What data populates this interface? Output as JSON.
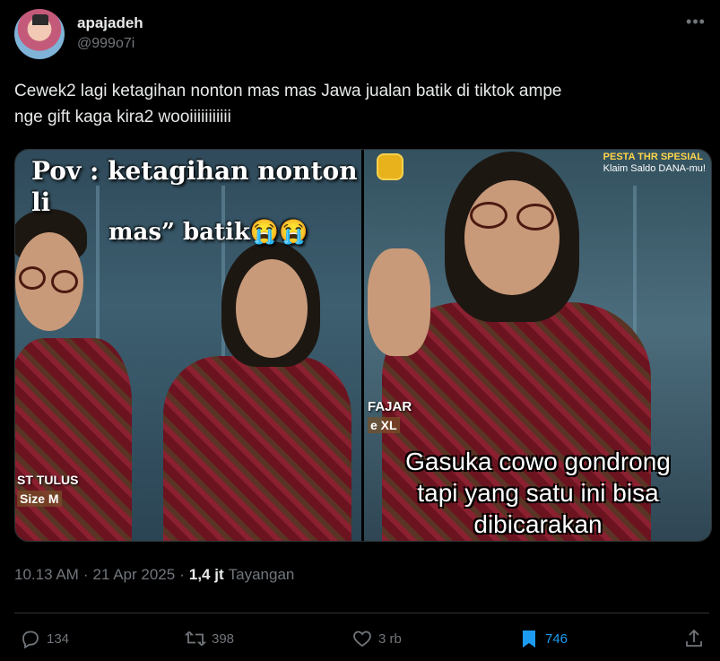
{
  "author": {
    "display_name": "apajadeh",
    "handle": "@999o7i"
  },
  "tweet": {
    "text": "Cewek2 lagi ketagihan nonton mas mas Jawa jualan batik di tiktok ampe\nnge gift kaga kira2 wooiiiiiiiiiii"
  },
  "media": {
    "left": {
      "caption_line1": "Pov : ketagihan nonton li",
      "caption_line2": "mas” batik😭😭",
      "name_label": "ST TULUS",
      "size_label": "Size M"
    },
    "right": {
      "promo_title": "PESTA THR SPESIAL",
      "promo_sub": "Klaim Saldo DANA-mu!",
      "name_label": "FAJAR",
      "size_label": "e XL",
      "caption": "Gasuka cowo gondrong\ntapi yang satu ini bisa\ndibicarakan"
    }
  },
  "meta": {
    "time": "10.13 AM",
    "sep1": "·",
    "date": "21 Apr 2025",
    "sep2": "·",
    "views": "1,4 jt",
    "views_label": "Tayangan"
  },
  "actions": {
    "replies": "134",
    "reposts": "398",
    "likes": "3 rb",
    "bookmarks": "746"
  },
  "colors": {
    "background": "#000000",
    "text_primary": "#e7e9ea",
    "text_secondary": "#71767b",
    "accent": "#1d9bf0",
    "divider": "#2f3336"
  }
}
